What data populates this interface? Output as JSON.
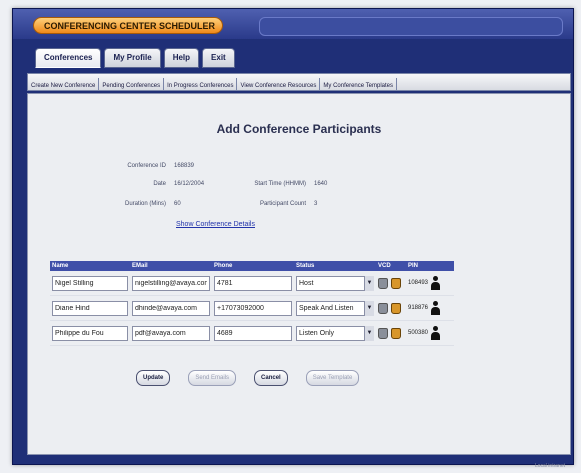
{
  "app": {
    "title": "CONFERENCING CENTER SCHEDULER"
  },
  "tabs": [
    {
      "label": "Conferences",
      "active": true
    },
    {
      "label": "My Profile",
      "active": false
    },
    {
      "label": "Help",
      "active": false
    },
    {
      "label": "Exit",
      "active": false
    }
  ],
  "subnav": [
    "Create New Conference",
    "Pending Conferences",
    "In Progress Conferences",
    "View Conference Resources",
    "My Conference Templates"
  ],
  "page": {
    "heading": "Add Conference Participants",
    "info": {
      "conference_id_label": "Conference ID",
      "conference_id": "168839",
      "date_label": "Date",
      "date": "16/12/2004",
      "start_time_label": "Start Time (HHMM)",
      "start_time": "1640",
      "duration_label": "Duration (Mins)",
      "duration": "60",
      "participant_count_label": "Participant Count",
      "participant_count": "3"
    },
    "details_link": "Show Conference Details"
  },
  "table": {
    "headers": {
      "name": "Name",
      "email": "EMail",
      "phone": "Phone",
      "status": "Status",
      "vcd": "VCD",
      "pin": "PIN"
    },
    "rows": [
      {
        "name": "Nigel Stilling",
        "email": "nigelstilling@avaya.com",
        "phone": "4781",
        "status": "Host",
        "pin": "108493"
      },
      {
        "name": "Diane Hind",
        "email": "dhinde@avaya.com",
        "phone": "+17073092000",
        "status": "Speak And Listen",
        "pin": "918876"
      },
      {
        "name": "Philippe du Fou",
        "email": "pdf@avaya.com",
        "phone": "4689",
        "status": "Listen Only",
        "pin": "500380"
      }
    ]
  },
  "buttons": {
    "update": "Update",
    "send_emails": "Send Emails",
    "cancel": "Cancel",
    "save_template": "Save Template"
  },
  "statusbar": {
    "text": "Local intranet"
  }
}
